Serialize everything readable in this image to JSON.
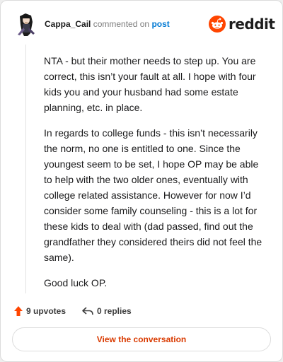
{
  "header": {
    "username": "Cappa_Cail",
    "commented_text": "commented on",
    "post_link": "post",
    "logo_text": "reddit",
    "avatar_icon": "anime-avatar-icon",
    "logo_icon": "reddit-snoo-icon"
  },
  "comment": {
    "paragraphs": [
      "NTA - but their mother needs to step up. You are correct, this isn’t your fault at all. I hope with four kids you and your husband had some estate planning, etc. in place.",
      "In regards to college funds - this isn’t necessarily the norm, no one is entitled to one. Since the youngest seem to be set, I hope OP may be able to help with the two older ones, eventually with college related assistance. However for now I’d consider some family counseling - this is a lot for these kids to deal with (dad passed, find out the grandfather they considered theirs did not feel the same).",
      "Good luck OP."
    ]
  },
  "actions": {
    "upvotes": "9 upvotes",
    "replies": "0 replies",
    "upvote_icon": "upvote-arrow-icon",
    "reply_icon": "reply-arrow-icon"
  },
  "view_button": "View the conversation",
  "colors": {
    "accent": "#d93a00",
    "upvote": "#ff4500",
    "link": "#0079d3",
    "reddit_orange": "#ff4500"
  }
}
